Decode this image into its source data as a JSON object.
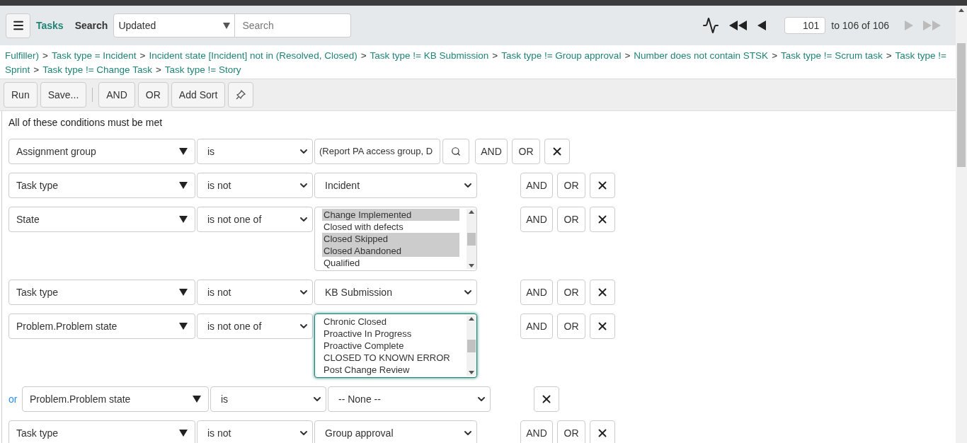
{
  "header": {
    "title": "Tasks",
    "search_label": "Search",
    "search_field": "Updated",
    "search_placeholder": "Search",
    "pager": {
      "page": "101",
      "range": "to 106 of 106",
      "next_disabled": true
    }
  },
  "breadcrumb_separator": ">",
  "breadcrumbs": [
    [
      "Fulfiller)",
      "Task type = Incident",
      "Incident state [Incident] not in (Resolved, Closed)",
      "Task type != KB Submission",
      "Task type != Group approval",
      "Number does not contain STSK",
      "Task type != Scrum task",
      "Task type !="
    ],
    [
      "Sprint",
      "Task type != Change Task",
      "Task type != Story"
    ]
  ],
  "toolbar": {
    "buttons": [
      "Run",
      "Save..."
    ],
    "logic_buttons": [
      "AND",
      "OR",
      "Add Sort"
    ]
  },
  "filter": {
    "heading": "All of these conditions must be met",
    "conditions": [
      {
        "kind": "reference",
        "field": "Assignment group",
        "operator": "is",
        "value": "(Report PA access group, D",
        "buttons": [
          "AND",
          "OR"
        ]
      },
      {
        "kind": "choice",
        "field": "Task type",
        "operator": "is not",
        "value": "Incident",
        "buttons": [
          "AND",
          "OR"
        ]
      },
      {
        "kind": "multi",
        "field": "State",
        "operator": "is not one of",
        "focused": false,
        "options": [
          {
            "label": "Change Implemented",
            "selected": true
          },
          {
            "label": "Closed with defects",
            "selected": false
          },
          {
            "label": "Closed Skipped",
            "selected": true
          },
          {
            "label": "Closed Abandoned",
            "selected": true
          },
          {
            "label": "Qualified",
            "selected": false
          }
        ],
        "buttons": [
          "AND",
          "OR"
        ]
      },
      {
        "kind": "choice",
        "field": "Task type",
        "operator": "is not",
        "value": "KB Submission",
        "buttons": [
          "AND",
          "OR"
        ]
      },
      {
        "kind": "multi",
        "field": "Problem.Problem state",
        "operator": "is not one of",
        "focused": true,
        "options": [
          {
            "label": "Chronic Closed",
            "selected": false
          },
          {
            "label": "Proactive In Progress",
            "selected": false
          },
          {
            "label": "Proactive Complete",
            "selected": false
          },
          {
            "label": "CLOSED TO KNOWN ERROR",
            "selected": false
          },
          {
            "label": "Post Change Review",
            "selected": false
          }
        ],
        "buttons": [
          "AND",
          "OR"
        ]
      },
      {
        "kind": "or",
        "prefix": "or",
        "field": "Problem.Problem state",
        "operator": "is",
        "value": "-- None --"
      },
      {
        "kind": "choice",
        "field": "Task type",
        "operator": "is not",
        "value": "Group approval",
        "buttons": [
          "AND",
          "OR"
        ]
      }
    ]
  }
}
